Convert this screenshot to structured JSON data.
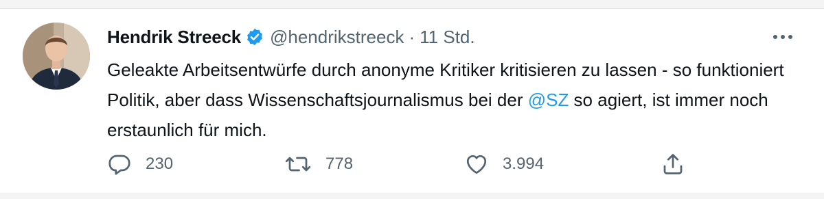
{
  "tweet": {
    "display_name": "Hendrik Streeck",
    "handle": "@hendrikstreeck",
    "separator": "·",
    "timestamp": "11 Std.",
    "text_part1": "Geleakte Arbeitsentwürfe durch anonyme Kritiker kritisieren zu lassen - so funktioniert Politik, aber dass Wissenschaftsjournalismus bei der ",
    "mention": "@SZ",
    "text_part2": " so agiert, ist immer noch erstaunlich für mich.",
    "verified": true
  },
  "actions": {
    "reply_count": "230",
    "retweet_count": "778",
    "like_count": "3.994"
  },
  "icons": {
    "verified": "verified-badge-icon",
    "more": "more-dots-icon",
    "reply": "reply-icon",
    "retweet": "retweet-icon",
    "like": "heart-icon",
    "share": "share-icon"
  },
  "colors": {
    "text_primary": "#0f1419",
    "text_secondary": "#536471",
    "accent": "#1d9bf0"
  }
}
